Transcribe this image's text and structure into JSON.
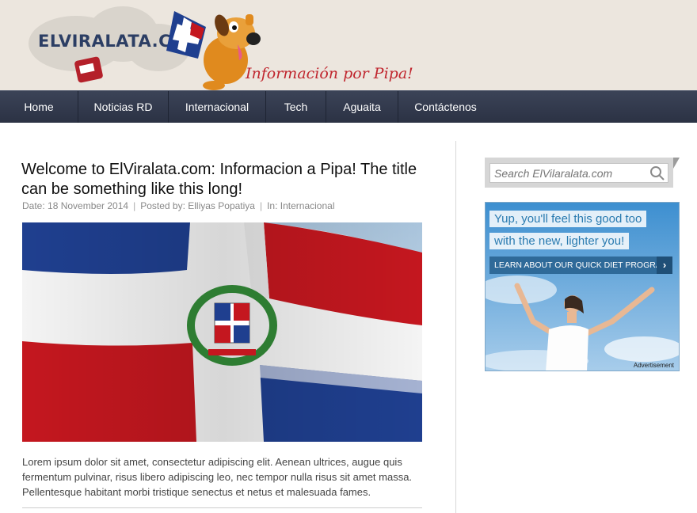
{
  "site": {
    "logo_text": "ELVIRALATA.COM",
    "tagline": "Información por Pipa!"
  },
  "nav": {
    "items": [
      "Home",
      "Noticias RD",
      "Internacional",
      "Tech",
      "Aguaita",
      "Contáctenos"
    ]
  },
  "post": {
    "title": "Welcome to ElViralata.com: Informacion a Pipa! The title can be something like this long!",
    "meta": {
      "date": "Date: 18 November 2014",
      "author": "Posted by: Elliyas Popatiya",
      "category": "In: Internacional",
      "separator": "|"
    },
    "excerpt": "Lorem ipsum dolor sit amet, consectetur adipiscing elit. Aenean ultrices, augue quis fermentum pulvinar, risus libero adipiscing leo, nec tempor nulla risus sit amet massa. Pellentesque habitant morbi tristique senectus et netus et malesuada fames."
  },
  "sidebar": {
    "search": {
      "placeholder": "Search ElVilaralata.com",
      "value": ""
    },
    "ad": {
      "line1": "Yup, you'll feel this good too",
      "line2": "with the new, lighter you!",
      "cta": "LEARN ABOUT OUR QUICK DIET PROGRAM",
      "cta_arrow": "›",
      "label": "Advertisement"
    }
  },
  "colors": {
    "header_bg": "#ece6de",
    "nav_bg": "#2f3648",
    "tagline": "#c0262e",
    "logo": "#2c3e64",
    "flag_blue": "#1f3f8f",
    "flag_red": "#c4171f",
    "ad_accent": "#2a7bb0"
  },
  "icons": [
    "search-icon",
    "mascot-dog-icon",
    "flag-image",
    "ad-image"
  ]
}
